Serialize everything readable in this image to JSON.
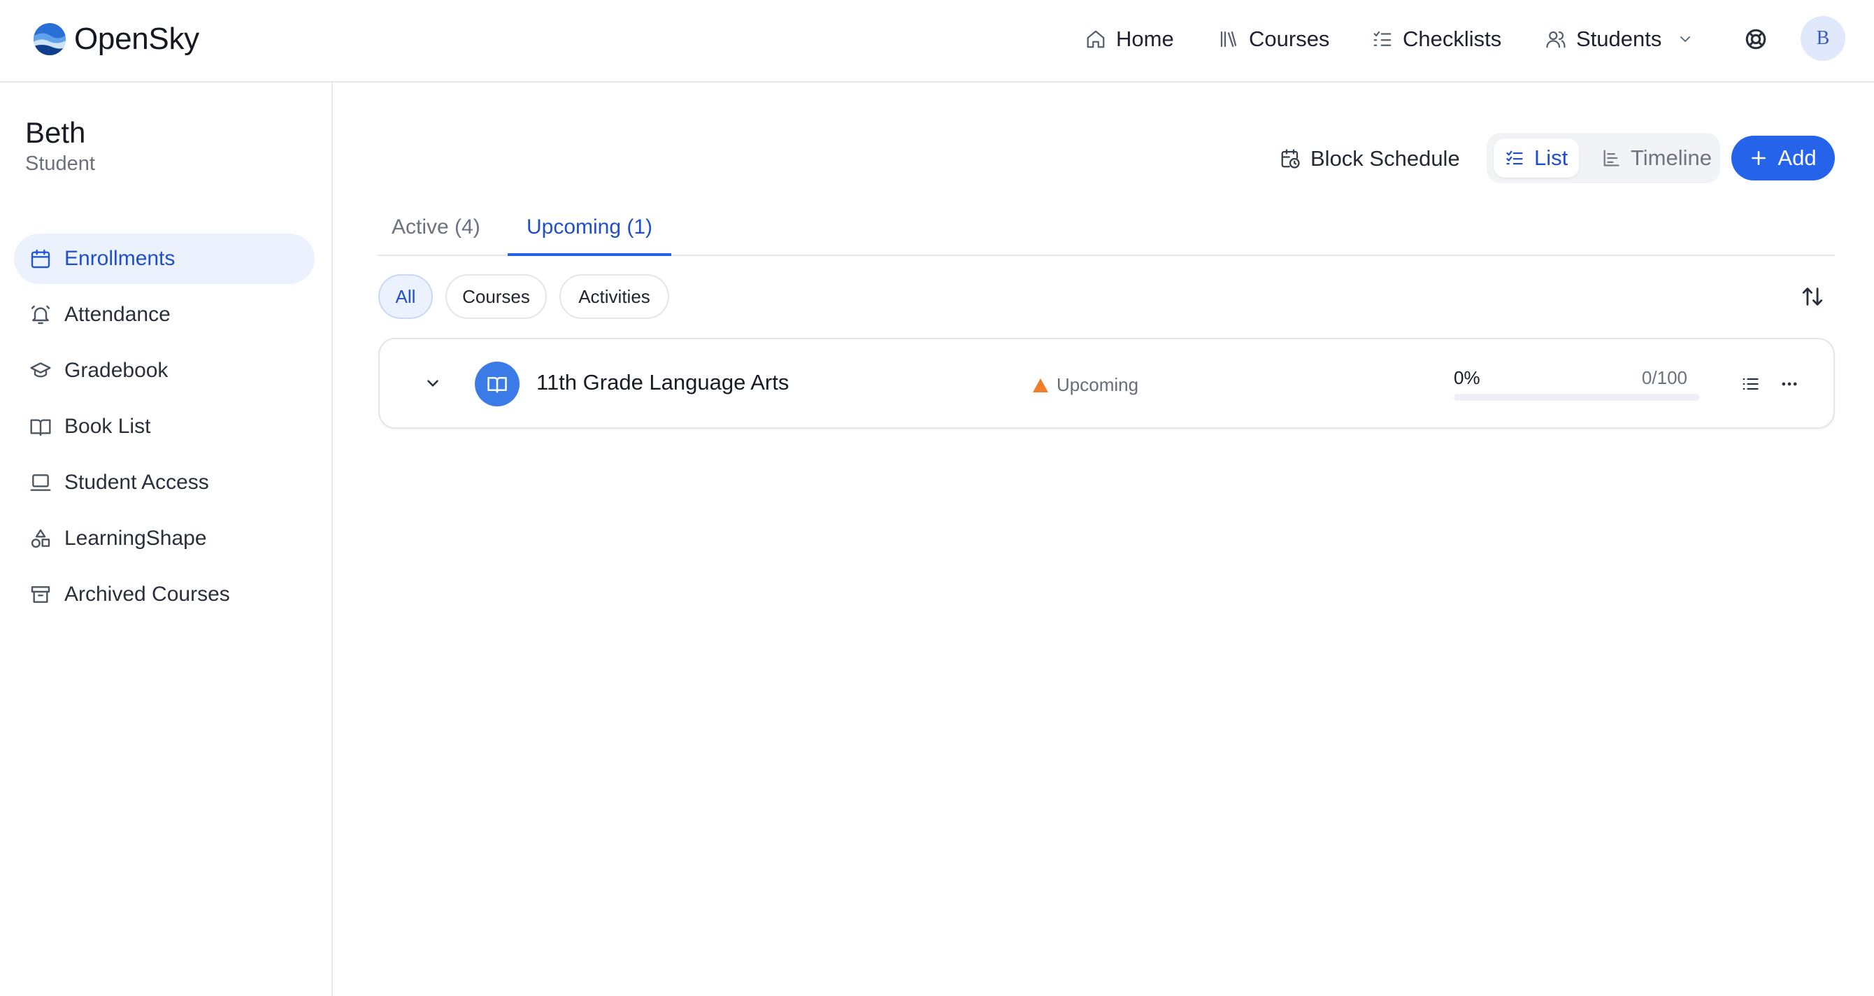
{
  "brand": {
    "name": "OpenSky"
  },
  "topnav": {
    "items": [
      {
        "label": "Home",
        "icon": "home-icon"
      },
      {
        "label": "Courses",
        "icon": "books-icon"
      },
      {
        "label": "Checklists",
        "icon": "checklist-icon"
      },
      {
        "label": "Students",
        "icon": "users-icon"
      }
    ],
    "avatar_initial": "B"
  },
  "sidebar": {
    "student_name": "Beth",
    "student_role": "Student",
    "items": [
      {
        "label": "Enrollments",
        "icon": "calendar-icon",
        "active": true
      },
      {
        "label": "Attendance",
        "icon": "bell-icon"
      },
      {
        "label": "Gradebook",
        "icon": "graduation-cap-icon"
      },
      {
        "label": "Book List",
        "icon": "open-book-icon"
      },
      {
        "label": "Student Access",
        "icon": "laptop-icon"
      },
      {
        "label": "LearningShape",
        "icon": "shapes-icon"
      },
      {
        "label": "Archived Courses",
        "icon": "archive-icon"
      }
    ]
  },
  "toolbar": {
    "block_schedule_label": "Block Schedule",
    "view_list_label": "List",
    "view_timeline_label": "Timeline",
    "active_view": "List",
    "add_label": "Add"
  },
  "tabs": [
    {
      "label": "Active (4)",
      "active": false
    },
    {
      "label": "Upcoming (1)",
      "active": true
    }
  ],
  "filters": [
    {
      "label": "All",
      "selected": true
    },
    {
      "label": "Courses",
      "selected": false
    },
    {
      "label": "Activities",
      "selected": false
    }
  ],
  "courses": [
    {
      "title": "11th Grade Language Arts",
      "status": "Upcoming",
      "progress_label": "0%",
      "progress_fraction": 0,
      "score": "0/100"
    }
  ],
  "colors": {
    "accent": "#2563eb",
    "active_bg": "#ebf2fd",
    "status_upcoming": "#f07d2a",
    "course_icon_bg": "#3b7be8"
  }
}
